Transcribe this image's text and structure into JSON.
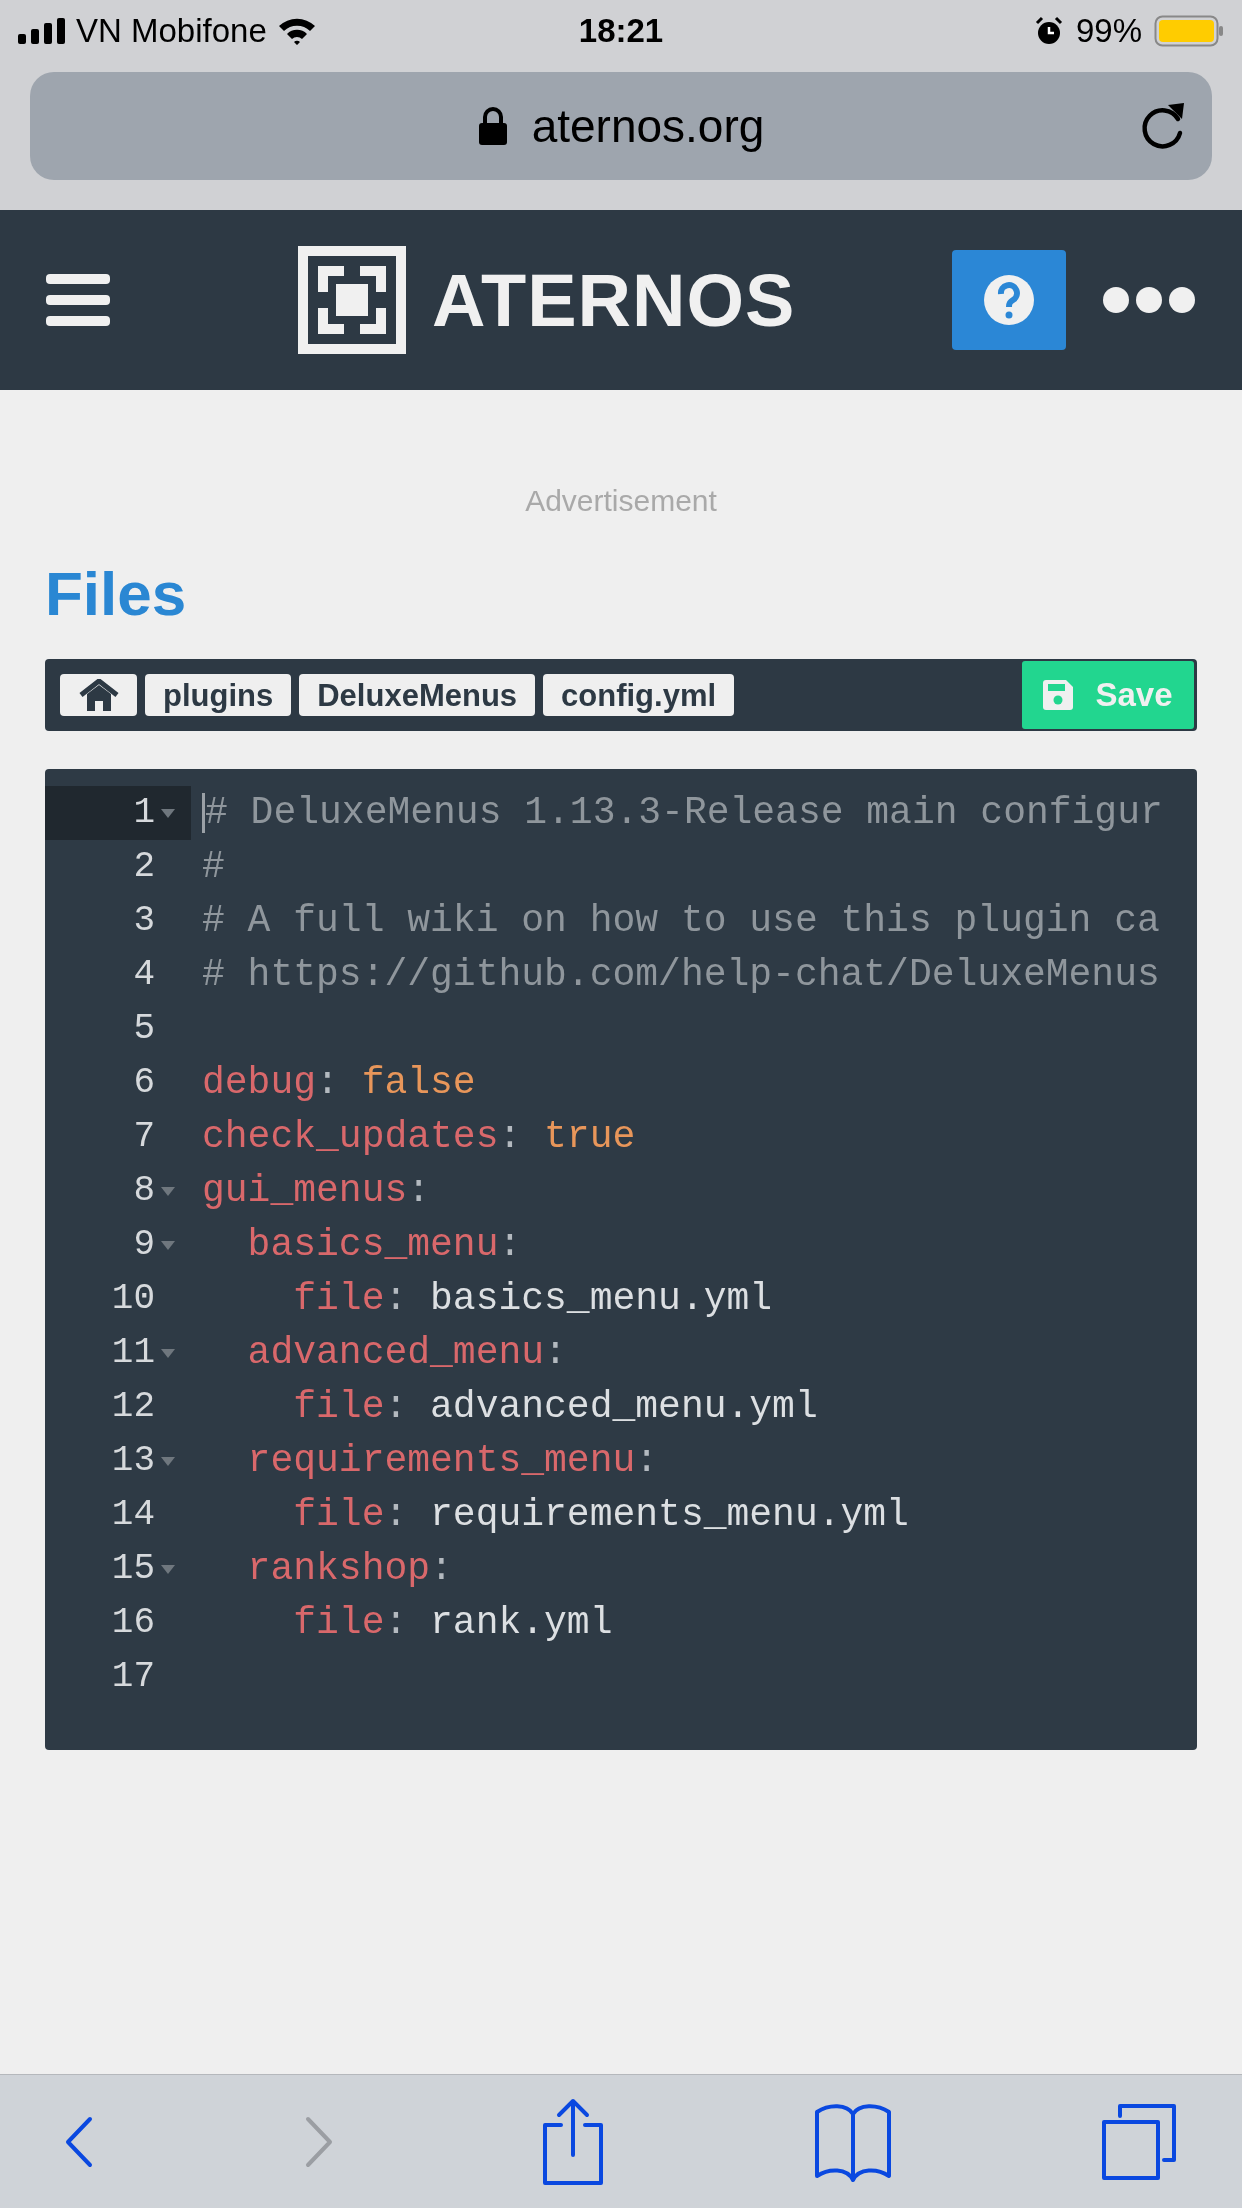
{
  "status_bar": {
    "carrier": "VN Mobifone",
    "time": "18:21",
    "battery": "99%"
  },
  "address_bar": {
    "url": "aternos.org"
  },
  "header": {
    "brand": "ATERNOS"
  },
  "advertisement": "Advertisement",
  "page_title": "Files",
  "breadcrumb": [
    "plugins",
    "DeluxeMenus",
    "config.yml"
  ],
  "save_button": "Save",
  "editor": {
    "lines": [
      {
        "number": "1",
        "fold": true,
        "active": true,
        "tokens": [
          {
            "kind": "comment",
            "text": "# DeluxeMenus 1.13.3-Release main configur"
          }
        ]
      },
      {
        "number": "2",
        "fold": false,
        "active": false,
        "tokens": [
          {
            "kind": "comment",
            "text": "#"
          }
        ]
      },
      {
        "number": "3",
        "fold": false,
        "active": false,
        "tokens": [
          {
            "kind": "comment",
            "text": "# A full wiki on how to use this plugin ca"
          }
        ]
      },
      {
        "number": "4",
        "fold": false,
        "active": false,
        "tokens": [
          {
            "kind": "comment",
            "text": "# https://github.com/help-chat/DeluxeMenus"
          }
        ]
      },
      {
        "number": "5",
        "fold": false,
        "active": false
      },
      {
        "number": "6",
        "fold": false,
        "active": false,
        "tokens": [
          {
            "kind": "key",
            "text": "debug"
          },
          {
            "kind": "punct",
            "text": ": "
          },
          {
            "kind": "bool",
            "text": "false"
          }
        ]
      },
      {
        "number": "7",
        "fold": false,
        "active": false,
        "tokens": [
          {
            "kind": "key",
            "text": "check_updates"
          },
          {
            "kind": "punct",
            "text": ": "
          },
          {
            "kind": "bool",
            "text": "true"
          }
        ]
      },
      {
        "number": "8",
        "fold": true,
        "active": false,
        "tokens": [
          {
            "kind": "key",
            "text": "gui_menus"
          },
          {
            "kind": "punct",
            "text": ":"
          }
        ]
      },
      {
        "number": "9",
        "fold": true,
        "active": false,
        "tokens": [
          {
            "kind": "key",
            "text": "  basics_menu"
          },
          {
            "kind": "punct",
            "text": ":"
          }
        ]
      },
      {
        "number": "10",
        "fold": false,
        "active": false,
        "tokens": [
          {
            "kind": "key",
            "text": "    file"
          },
          {
            "kind": "punct",
            "text": ": "
          },
          {
            "kind": "text",
            "text": "basics_menu.yml"
          }
        ]
      },
      {
        "number": "11",
        "fold": true,
        "active": false,
        "tokens": [
          {
            "kind": "key",
            "text": "  advanced_menu"
          },
          {
            "kind": "punct",
            "text": ":"
          }
        ]
      },
      {
        "number": "12",
        "fold": false,
        "active": false,
        "tokens": [
          {
            "kind": "key",
            "text": "    file"
          },
          {
            "kind": "punct",
            "text": ": "
          },
          {
            "kind": "text",
            "text": "advanced_menu.yml"
          }
        ]
      },
      {
        "number": "13",
        "fold": true,
        "active": false,
        "tokens": [
          {
            "kind": "key",
            "text": "  requirements_menu"
          },
          {
            "kind": "punct",
            "text": ":"
          }
        ]
      },
      {
        "number": "14",
        "fold": false,
        "active": false,
        "tokens": [
          {
            "kind": "key",
            "text": "    file"
          },
          {
            "kind": "punct",
            "text": ": "
          },
          {
            "kind": "text",
            "text": "requirements_menu.yml"
          }
        ]
      },
      {
        "number": "15",
        "fold": true,
        "active": false,
        "tokens": [
          {
            "kind": "key",
            "text": "  rankshop"
          },
          {
            "kind": "punct",
            "text": ":"
          }
        ]
      },
      {
        "number": "16",
        "fold": false,
        "active": false,
        "tokens": [
          {
            "kind": "key",
            "text": "    file"
          },
          {
            "kind": "punct",
            "text": ": "
          },
          {
            "kind": "text",
            "text": "rank.yml"
          }
        ]
      },
      {
        "number": "17",
        "fold": false,
        "active": false
      }
    ]
  },
  "toolbar": [
    {
      "kind": "back",
      "disabled": false
    },
    {
      "kind": "forward",
      "disabled": true
    },
    {
      "kind": "share",
      "disabled": false
    },
    {
      "kind": "bookmarks",
      "disabled": false
    },
    {
      "kind": "tabs",
      "disabled": false
    }
  ]
}
